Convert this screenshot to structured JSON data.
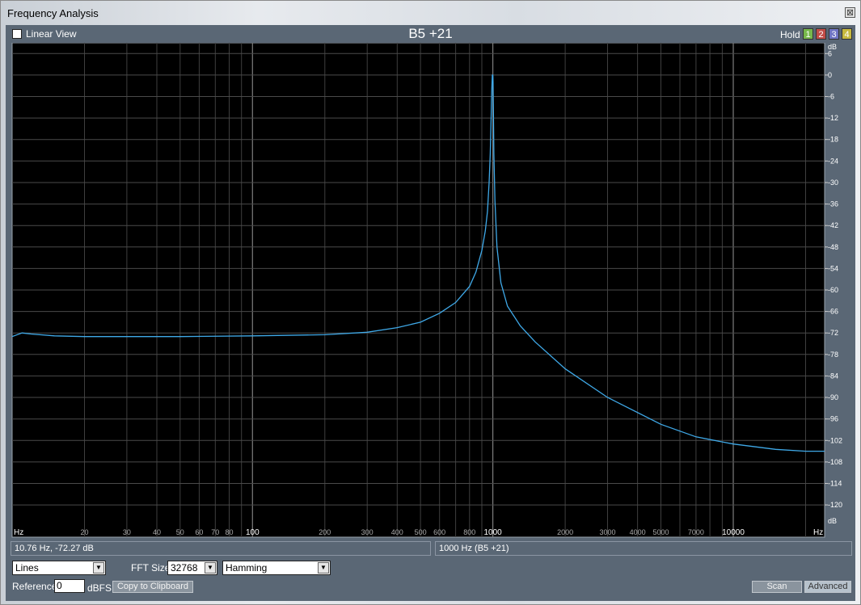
{
  "window": {
    "title": "Frequency Analysis",
    "close_glyph": "⊠"
  },
  "toolbar": {
    "linear_view_label": "Linear View",
    "linear_view_checked": false,
    "note_readout": "B5 +21",
    "hold_label": "Hold",
    "hold_buttons": [
      {
        "label": "1",
        "color": "#77b84c"
      },
      {
        "label": "2",
        "color": "#c24c47"
      },
      {
        "label": "3",
        "color": "#6f74c4"
      },
      {
        "label": "4",
        "color": "#c7b93f"
      }
    ]
  },
  "chart_data": {
    "type": "line",
    "x_scale": "log",
    "xlim": [
      10,
      24000
    ],
    "ylim": [
      -129,
      9
    ],
    "grid": true,
    "xlabel": "Hz",
    "ylabel": "dB",
    "x_tick_labels": [
      {
        "v": 20,
        "t": "20"
      },
      {
        "v": 30,
        "t": "30"
      },
      {
        "v": 40,
        "t": "40"
      },
      {
        "v": 50,
        "t": "50"
      },
      {
        "v": 60,
        "t": "60"
      },
      {
        "v": 70,
        "t": "70"
      },
      {
        "v": 80,
        "t": "80"
      },
      {
        "v": 100,
        "t": "100"
      },
      {
        "v": 200,
        "t": "200"
      },
      {
        "v": 300,
        "t": "300"
      },
      {
        "v": 400,
        "t": "400"
      },
      {
        "v": 500,
        "t": "500"
      },
      {
        "v": 600,
        "t": "600"
      },
      {
        "v": 800,
        "t": "800"
      },
      {
        "v": 1000,
        "t": "1000"
      },
      {
        "v": 2000,
        "t": "2000"
      },
      {
        "v": 3000,
        "t": "3000"
      },
      {
        "v": 4000,
        "t": "4000"
      },
      {
        "v": 5000,
        "t": "5000"
      },
      {
        "v": 7000,
        "t": "7000"
      },
      {
        "v": 10000,
        "t": "10000"
      }
    ],
    "y_ticks": [
      6,
      0,
      -6,
      -12,
      -18,
      -24,
      -30,
      -36,
      -42,
      -48,
      -54,
      -60,
      -66,
      -72,
      -78,
      -84,
      -90,
      -96,
      -102,
      -108,
      -114,
      -120
    ],
    "series": [
      {
        "color": "#3fa9e8",
        "x": [
          10,
          11,
          12,
          15,
          20,
          30,
          50,
          100,
          200,
          300,
          400,
          500,
          600,
          700,
          800,
          850,
          900,
          930,
          950,
          965,
          975,
          985,
          990,
          995,
          998,
          1000,
          1002,
          1005,
          1010,
          1020,
          1040,
          1080,
          1150,
          1300,
          1500,
          2000,
          3000,
          5000,
          7000,
          10000,
          15000,
          20000,
          24000
        ],
        "y": [
          -73,
          -72,
          -72.3,
          -72.8,
          -73,
          -73,
          -73,
          -72.8,
          -72.5,
          -71.8,
          -70.5,
          -69,
          -66.5,
          -63.5,
          -59,
          -55,
          -49,
          -43.5,
          -38,
          -30,
          -22,
          -10,
          -4,
          0,
          0,
          0,
          -2,
          -10,
          -22,
          -35,
          -48,
          -58,
          -64.5,
          -70,
          -74.5,
          -82,
          -90,
          -97.5,
          -101,
          -103,
          -104.5,
          -105,
          -105
        ]
      }
    ]
  },
  "status": {
    "cursor_readout": "10.76 Hz, -72.27 dB",
    "peak_readout": "1000 Hz (B5 +21)"
  },
  "controls": {
    "display_mode": "Lines",
    "fft_size_label": "FFT Size",
    "fft_size": "32768",
    "window_function": "Hamming",
    "reference_label": "Reference",
    "reference_value": "0",
    "reference_unit": "dBFS",
    "copy_label": "Copy to Clipboard",
    "scan_label": "Scan",
    "advanced_label": "Advanced"
  }
}
